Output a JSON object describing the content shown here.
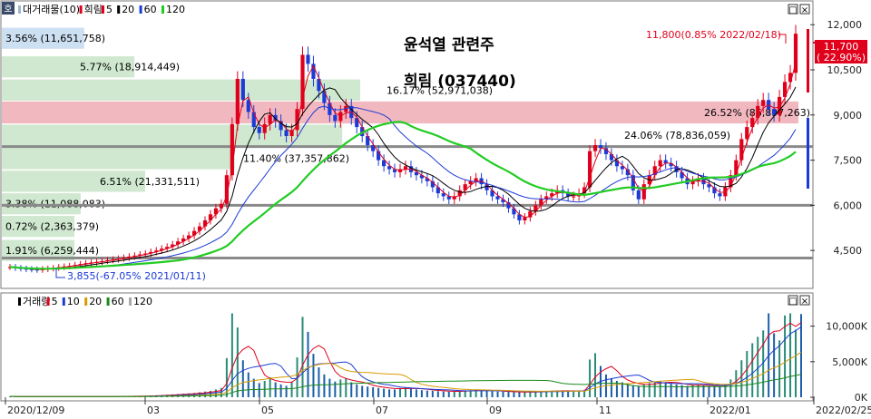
{
  "corner_label": "호",
  "panel_buttons": [
    "□",
    "×"
  ],
  "price_legend": {
    "items": [
      {
        "text": "대거래물(10)",
        "color": "#9ab8d4"
      },
      {
        "text": "희림",
        "color": "#e0001b"
      },
      {
        "text": "5",
        "color": "#e0001b"
      },
      {
        "text": "20",
        "color": "#000000"
      },
      {
        "text": "60",
        "color": "#1c3bd6"
      },
      {
        "text": "120",
        "color": "#22cc22"
      }
    ]
  },
  "volume_legend": {
    "items": [
      {
        "text": "거래량",
        "color": "#000000"
      },
      {
        "text": "5",
        "color": "#e0001b"
      },
      {
        "text": "10",
        "color": "#1c3bd6"
      },
      {
        "text": "20",
        "color": "#d99a00"
      },
      {
        "text": "60",
        "color": "#1a8a1a"
      },
      {
        "text": "120",
        "color": "#aaaaaa"
      }
    ]
  },
  "title_lines": [
    "윤석열 관련주",
    "희림 (037440)"
  ],
  "annotations": {
    "high": "11,800(0.85% 2022/02/18)",
    "low": "3,855(-67.05% 2021/01/11)",
    "current_price": "11,700",
    "current_change": "( 22.90%)"
  },
  "colors": {
    "up": "#e0001b",
    "down": "#1c3bd6",
    "ma5": "#e0001b",
    "ma20": "#000000",
    "ma60": "#1c3bd6",
    "ma120": "#22cc22",
    "band_green": "#cfe8cf",
    "band_blue": "#cde0f2",
    "band_red": "#f2b8c0"
  },
  "chart_data": [
    {
      "type": "candlestick",
      "name": "price",
      "y_ticks": [
        "12,000",
        "10,500",
        "9,000",
        "7,500",
        "6,000",
        "4,500"
      ],
      "ylim": [
        3300,
        12700
      ],
      "x_tick_labels": [
        "2020/12/09",
        "03",
        "05",
        "07",
        "09",
        "11",
        "2022/01",
        "2022/02/25"
      ],
      "volume_profile": [
        {
          "label": "3.56% (11,651,758)",
          "color": "blue",
          "low": 11200,
          "high": 11900,
          "width": 0.23
        },
        {
          "label": "5.77% (18,914,449)",
          "color": "green",
          "low": 10250,
          "high": 10950,
          "width": 0.37
        },
        {
          "label": "16.17% (52,971,038)",
          "color": "green",
          "low": 9480,
          "high": 10180,
          "width": 1.0
        },
        {
          "label": "26.52% (86,897,263)",
          "color": "red",
          "low": 8720,
          "high": 9450,
          "width": 1.0
        },
        {
          "label": "24.06% (78,836,059)",
          "color": "green",
          "low": 7980,
          "high": 8680,
          "width": 0.95
        },
        {
          "label": "11.40% (37,357,862)",
          "color": "green",
          "low": 7200,
          "high": 7920,
          "width": 0.65
        },
        {
          "label": "6.51% (21,331,511)",
          "color": "green",
          "low": 6450,
          "high": 7150,
          "width": 0.4
        },
        {
          "label": "3.38% (11,088,083)",
          "color": "green",
          "low": 5700,
          "high": 6400,
          "width": 0.22
        },
        {
          "label": "0.72% (2,363,379)",
          "color": "green",
          "low": 4950,
          "high": 5650,
          "width": 0.2
        },
        {
          "label": "1.91% (6,259,444)",
          "color": "green",
          "low": 4150,
          "high": 4850,
          "width": 0.2
        }
      ],
      "horizontal_lines": [
        7950,
        6000,
        4250
      ],
      "closes": [
        3950,
        3920,
        3900,
        3880,
        3870,
        3855,
        3880,
        3900,
        3920,
        3950,
        3970,
        3990,
        4020,
        4050,
        4080,
        4100,
        4120,
        4150,
        4180,
        4200,
        4230,
        4260,
        4300,
        4330,
        4370,
        4400,
        4450,
        4500,
        4560,
        4620,
        4700,
        4800,
        4900,
        5000,
        5150,
        5300,
        5500,
        5700,
        5900,
        6050,
        7000,
        8700,
        10200,
        9500,
        9100,
        8600,
        8400,
        8700,
        9000,
        8800,
        8500,
        8300,
        8500,
        9200,
        11000,
        10700,
        10200,
        9800,
        9400,
        9000,
        8800,
        9100,
        9300,
        8900,
        8600,
        8300,
        8000,
        7800,
        7500,
        7300,
        7200,
        7100,
        7200,
        7300,
        7100,
        7000,
        6900,
        6800,
        6600,
        6400,
        6300,
        6200,
        6300,
        6500,
        6700,
        6800,
        6900,
        6700,
        6500,
        6300,
        6200,
        6100,
        5900,
        5700,
        5500,
        5600,
        5800,
        6000,
        6200,
        6300,
        6400,
        6500,
        6400,
        6300,
        6300,
        6400,
        6600,
        7800,
        8000,
        7900,
        7700,
        7500,
        7300,
        7200,
        7000,
        6500,
        6200,
        6700,
        7000,
        7300,
        7500,
        7400,
        7300,
        7100,
        6900,
        6700,
        6800,
        6900,
        6700,
        6600,
        6400,
        6300,
        6600,
        7000,
        7500,
        8200,
        8600,
        8900,
        9300,
        9500,
        9200,
        9000,
        9600,
        10100,
        10400,
        11700
      ]
    },
    {
      "type": "bar",
      "name": "volume",
      "y_ticks": [
        "10,000K",
        "5,000K",
        "0K"
      ],
      "ylim": [
        0,
        12500
      ],
      "values": [
        120,
        100,
        90,
        80,
        80,
        150,
        90,
        80,
        70,
        70,
        80,
        80,
        90,
        90,
        100,
        100,
        110,
        120,
        110,
        120,
        140,
        130,
        150,
        160,
        180,
        200,
        220,
        260,
        300,
        350,
        400,
        450,
        500,
        550,
        600,
        700,
        800,
        900,
        1100,
        1300,
        5500,
        11800,
        9800,
        5200,
        3500,
        2600,
        2000,
        2300,
        2800,
        2100,
        1800,
        1600,
        2200,
        5600,
        11300,
        9200,
        6100,
        4200,
        3200,
        2600,
        2200,
        2500,
        2700,
        2100,
        1800,
        1600,
        1500,
        1400,
        1300,
        1200,
        1100,
        1100,
        1300,
        1400,
        1200,
        1100,
        1000,
        950,
        900,
        850,
        800,
        780,
        820,
        900,
        950,
        1000,
        1100,
        1000,
        900,
        850,
        800,
        780,
        750,
        720,
        700,
        720,
        760,
        800,
        840,
        880,
        920,
        960,
        900,
        860,
        850,
        900,
        1000,
        5300,
        6200,
        4400,
        3200,
        2600,
        2300,
        2100,
        1900,
        1700,
        1600,
        1800,
        2000,
        2200,
        2300,
        2100,
        1900,
        1800,
        1700,
        1600,
        1700,
        1800,
        1700,
        1600,
        1500,
        1500,
        1800,
        2500,
        3800,
        5200,
        6500,
        7600,
        8500,
        9400,
        11800,
        9000,
        8000,
        11500,
        11800,
        9500,
        11700
      ]
    }
  ]
}
